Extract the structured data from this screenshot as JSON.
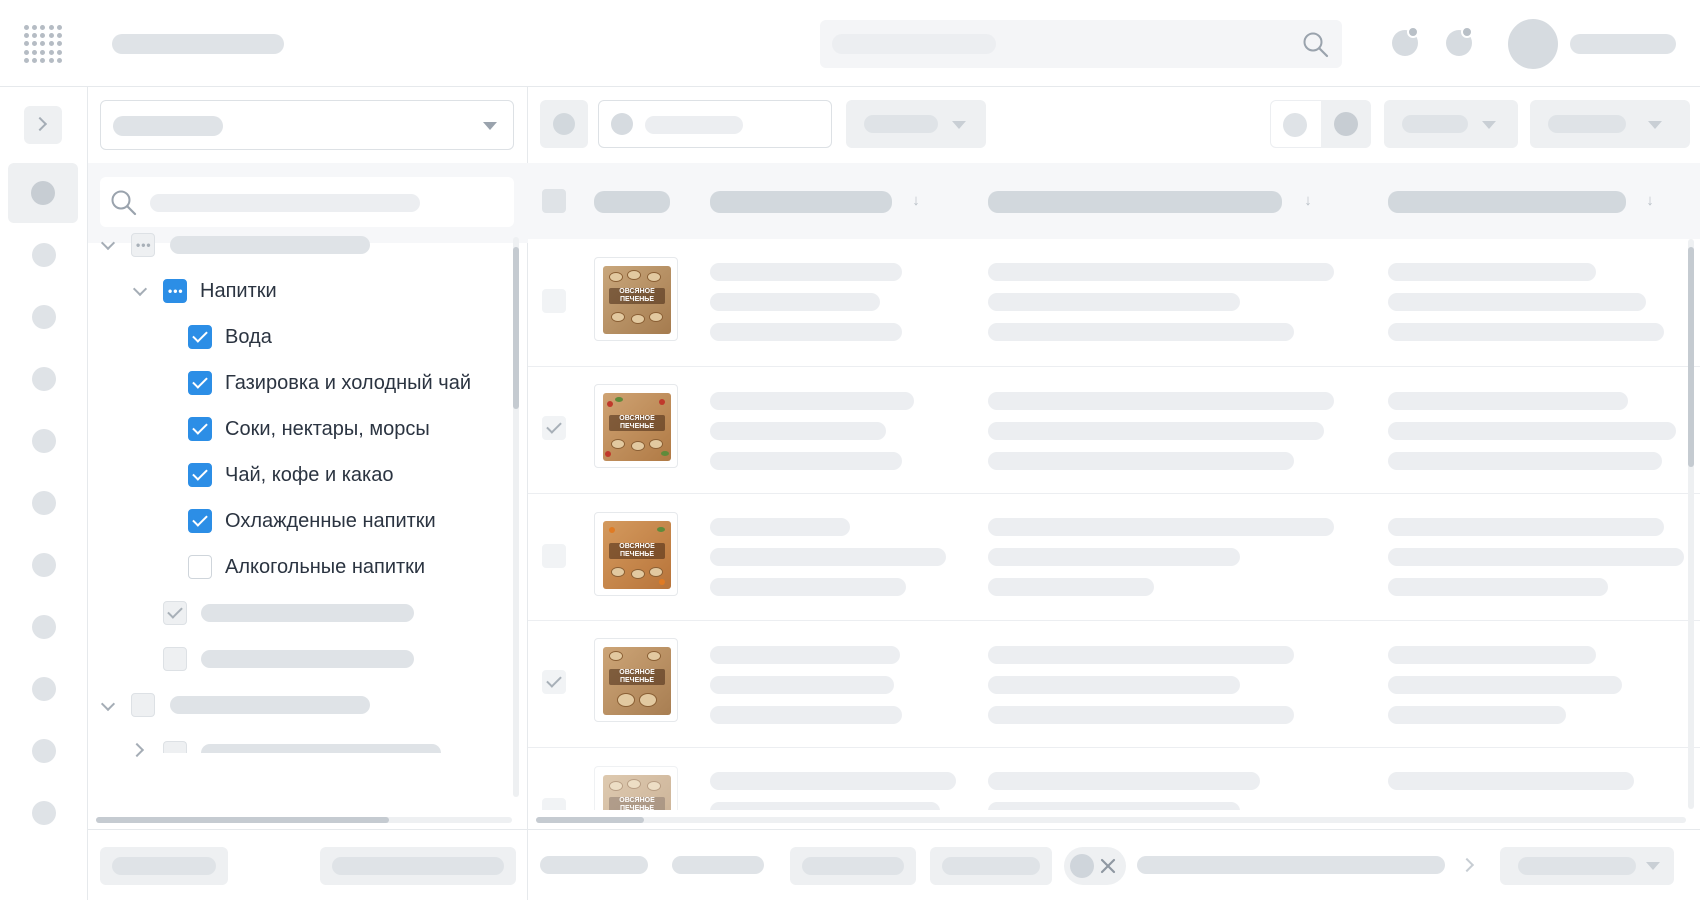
{
  "tree": {
    "group_label": "Напитки",
    "items": [
      {
        "label": "Вода",
        "checked": true
      },
      {
        "label": "Газировка и холодный чай",
        "checked": true
      },
      {
        "label": "Соки, нектары, морсы",
        "checked": true
      },
      {
        "label": "Чай, кофе и какао",
        "checked": true
      },
      {
        "label": "Охлажденные напитки",
        "checked": true
      },
      {
        "label": "Алкогольные напитки",
        "checked": false
      }
    ]
  },
  "products": [
    {
      "name": "ОВСЯНОЕ ПЕЧЕНЬЕ",
      "checked": false
    },
    {
      "name": "ОВСЯНОЕ ПЕЧЕНЬЕ",
      "checked": true
    },
    {
      "name": "ОВСЯНОЕ ПЕЧЕНЬЕ",
      "checked": false
    },
    {
      "name": "ОВСЯНОЕ ПЕЧЕНЬЕ",
      "checked": true
    },
    {
      "name": "ОВСЯНОЕ ПЕЧЕНЬЕ",
      "checked": false
    }
  ],
  "icons": {
    "apps": "apps-grid-icon",
    "search": "search-icon",
    "notifications": "notification-icon",
    "messages": "message-icon",
    "expand": "chevron-right-icon",
    "dropdown": "chevron-down-icon",
    "sort": "arrow-down-icon",
    "clear": "close-icon"
  },
  "colors": {
    "accent": "#2c8ee6",
    "skeleton": "#dfe3e7",
    "border": "#e6e9ec"
  }
}
